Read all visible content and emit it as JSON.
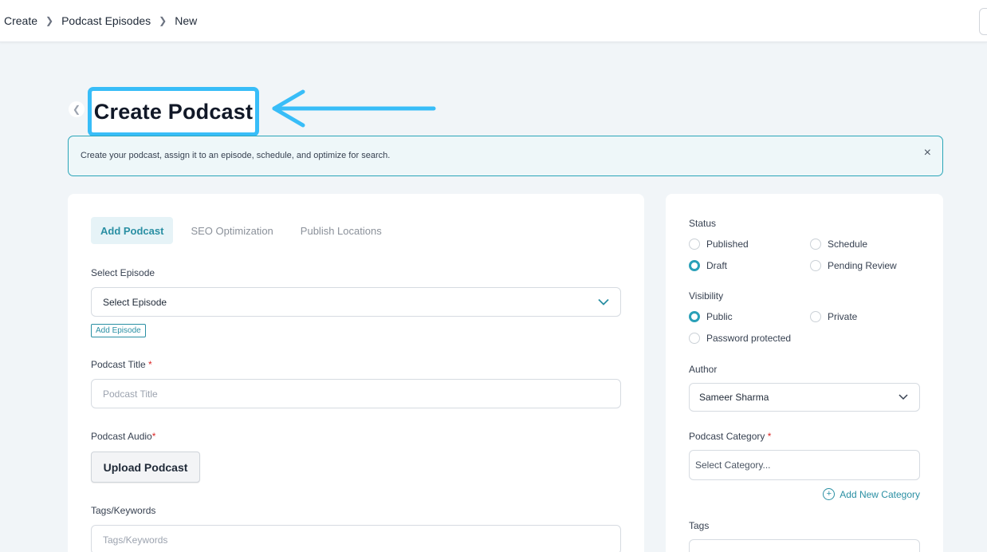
{
  "breadcrumb": [
    "Create",
    "Podcast Episodes",
    "New"
  ],
  "page": {
    "title": "Create Podcast"
  },
  "banner": {
    "text": "Create your podcast, assign it to an episode, schedule, and optimize for search.",
    "close": "×"
  },
  "tabs": [
    "Add Podcast",
    "SEO Optimization",
    "Publish Locations"
  ],
  "form": {
    "episode_label": "Select Episode",
    "episode_value": "Select Episode",
    "add_episode": "Add Episode",
    "title_label": "Podcast Title",
    "required_mark": "*",
    "title_placeholder": "Podcast Title",
    "audio_label": "Podcast Audio",
    "upload_label": "Upload Podcast",
    "tags_label": "Tags/Keywords",
    "tags_placeholder": "Tags/Keywords"
  },
  "sidebar": {
    "status_label": "Status",
    "status_options": [
      "Published",
      "Schedule",
      "Draft",
      "Pending Review"
    ],
    "status_selected": "Draft",
    "visibility_label": "Visibility",
    "visibility_options": [
      "Public",
      "Private",
      "Password protected"
    ],
    "visibility_selected": "Public",
    "author_label": "Author",
    "author_value": "Sameer Sharma",
    "category_label": "Podcast Category",
    "category_placeholder": "Select Category...",
    "add_category": "Add New Category",
    "tags_label": "Tags"
  },
  "colors": {
    "accent": "#2a8fa3",
    "annotation": "#38bdf8",
    "required": "#dc2626"
  }
}
